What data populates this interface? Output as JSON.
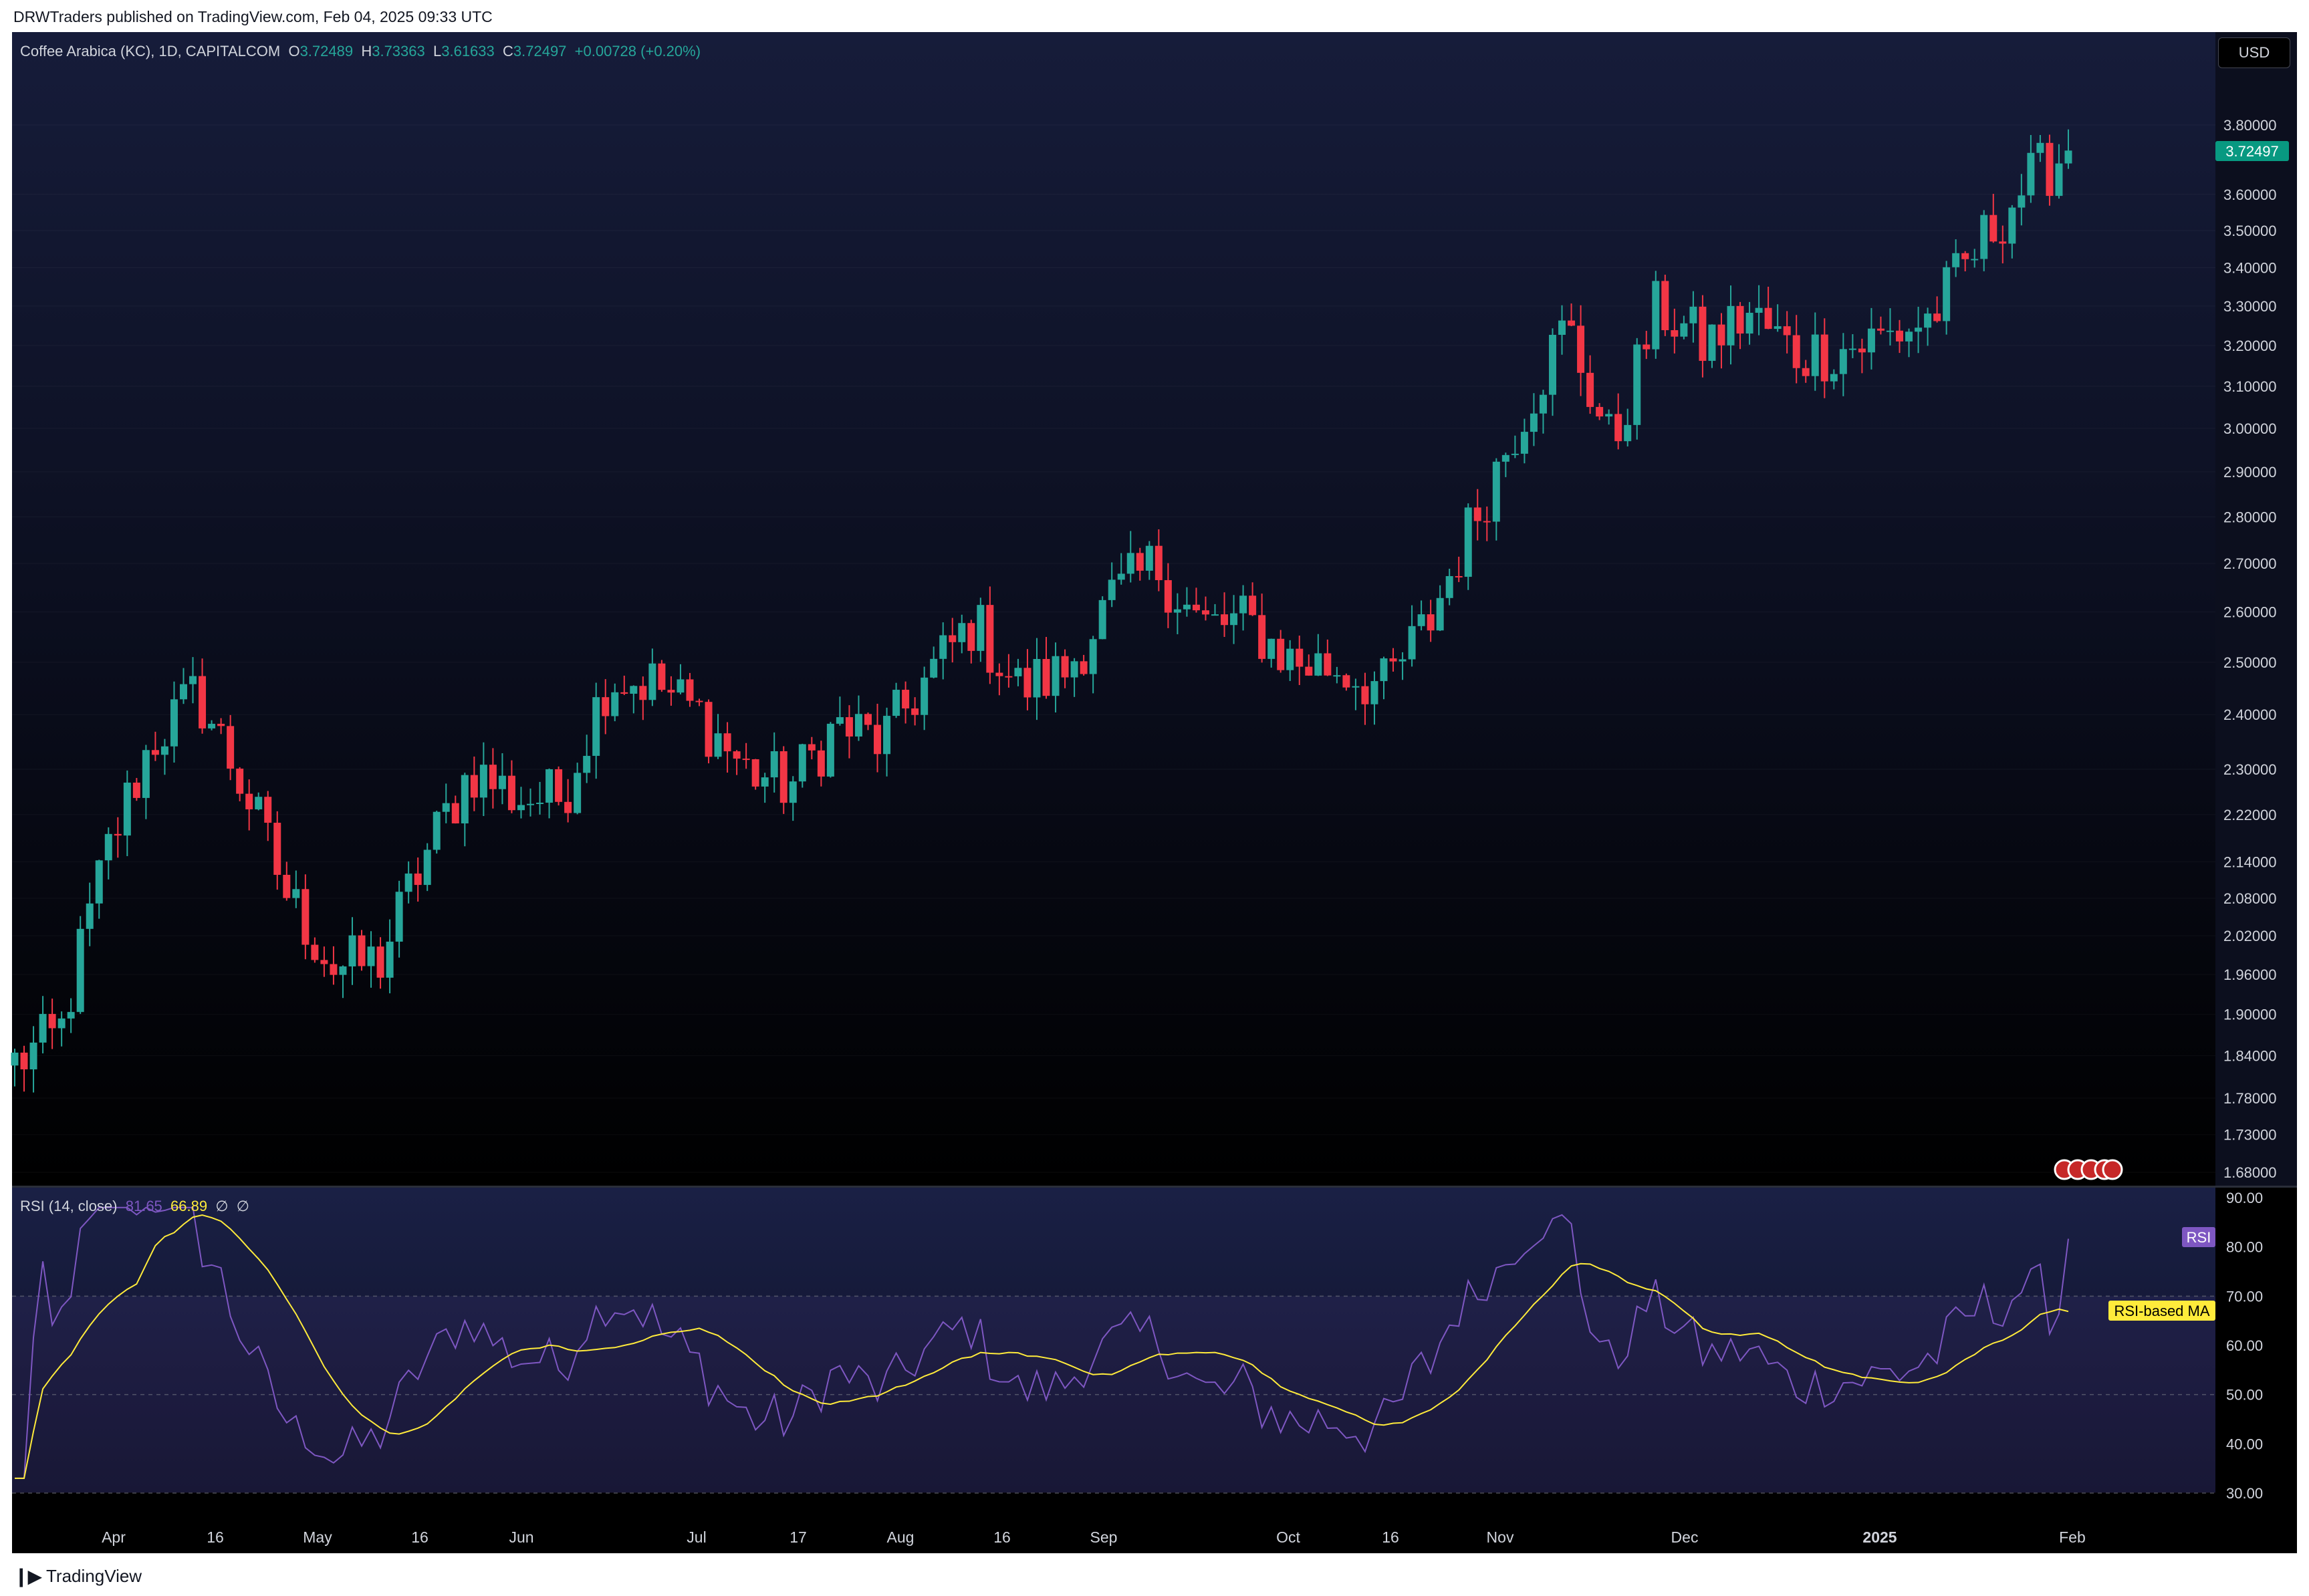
{
  "header": {
    "published": "DRWTraders published on TradingView.com, Feb 04, 2025 09:33 UTC"
  },
  "footer": {
    "brand": "TradingView",
    "logo_icon": "tradingview-logo-icon"
  },
  "legend": {
    "symbol": "Coffee Arabica (KC), 1D, CAPITALCOM",
    "o_label": "O",
    "o_value": "3.72489",
    "h_label": "H",
    "h_value": "3.73363",
    "l_label": "L",
    "l_value": "3.61633",
    "c_label": "C",
    "c_value": "3.72497",
    "change": "+0.00728 (+0.20%)"
  },
  "rsi_legend": {
    "label": "RSI (14, close)",
    "rsi_value": "81.65",
    "ma_value": "66.89",
    "icon1": "∅",
    "icon2": "∅"
  },
  "currency_button": "USD",
  "price_tag": "3.72497",
  "rsi_tag": "RSI",
  "rsi_ma_tag": "RSI-based MA",
  "colors": {
    "up": "#26a69a",
    "down": "#f23645",
    "rsi": "#7e57c2",
    "rsi_ma": "#ffeb3b",
    "background": "#000000"
  },
  "chart_data": [
    {
      "type": "candlestick",
      "title": "Coffee Arabica (KC), 1D, CAPITALCOM",
      "scale": "log",
      "y_ticks": [
        "3.80000",
        "3.60000",
        "3.50000",
        "3.40000",
        "3.30000",
        "3.20000",
        "3.10000",
        "3.00000",
        "2.90000",
        "2.80000",
        "2.70000",
        "2.60000",
        "2.50000",
        "2.40000",
        "2.30000",
        "2.22000",
        "2.14000",
        "2.08000",
        "2.02000",
        "1.96000",
        "1.90000",
        "1.84000",
        "1.78000",
        "1.73000",
        "1.68000"
      ],
      "x_ticks": [
        "Apr",
        "16",
        "May",
        "16",
        "Jun",
        "Jul",
        "17",
        "Aug",
        "16",
        "Sep",
        "Oct",
        "16",
        "Nov",
        "Dec",
        "2025",
        "Feb"
      ],
      "ohlc_approx": [
        {
          "date": "Mar 21",
          "close": 1.83
        },
        {
          "date": "Apr 01",
          "close": 1.87
        },
        {
          "date": "Apr 11",
          "close": 2.15
        },
        {
          "date": "Apr 16",
          "close": 2.35
        },
        {
          "date": "Apr 17",
          "close": 2.44
        },
        {
          "date": "Apr 24",
          "close": 2.27
        },
        {
          "date": "May 01",
          "close": 2.08
        },
        {
          "date": "May 06",
          "close": 1.97
        },
        {
          "date": "May 16",
          "close": 1.98
        },
        {
          "date": "May 27",
          "close": 2.15
        },
        {
          "date": "Jun 04",
          "close": 2.3
        },
        {
          "date": "Jun 14",
          "close": 2.25
        },
        {
          "date": "Jun 26",
          "close": 2.25
        },
        {
          "date": "Jul 03",
          "close": 2.47
        },
        {
          "date": "Jul 10",
          "close": 2.46
        },
        {
          "date": "Jul 17",
          "close": 2.4
        },
        {
          "date": "Jul 24",
          "close": 2.3
        },
        {
          "date": "Aug 02",
          "close": 2.27
        },
        {
          "date": "Aug 09",
          "close": 2.38
        },
        {
          "date": "Aug 16",
          "close": 2.35
        },
        {
          "date": "Aug 23",
          "close": 2.47
        },
        {
          "date": "Aug 30",
          "close": 2.58
        },
        {
          "date": "Sep 06",
          "close": 2.45
        },
        {
          "date": "Sep 13",
          "close": 2.48
        },
        {
          "date": "Sep 20",
          "close": 2.62
        },
        {
          "date": "Sep 27",
          "close": 2.7
        },
        {
          "date": "Oct 04",
          "close": 2.57
        },
        {
          "date": "Oct 11",
          "close": 2.58
        },
        {
          "date": "Oct 18",
          "close": 2.5
        },
        {
          "date": "Oct 25",
          "close": 2.49
        },
        {
          "date": "Nov 01",
          "close": 2.45
        },
        {
          "date": "Nov 08",
          "close": 2.58
        },
        {
          "date": "Nov 15",
          "close": 2.8
        },
        {
          "date": "Nov 22",
          "close": 3.03
        },
        {
          "date": "Nov 29",
          "close": 3.25
        },
        {
          "date": "Dec 03",
          "close": 2.95
        },
        {
          "date": "Dec 10",
          "close": 3.3
        },
        {
          "date": "Dec 17",
          "close": 3.2
        },
        {
          "date": "Dec 24",
          "close": 3.28
        },
        {
          "date": "Dec 31",
          "close": 3.18
        },
        {
          "date": "Jan 08",
          "close": 3.19
        },
        {
          "date": "Jan 15",
          "close": 3.22
        },
        {
          "date": "Jan 22",
          "close": 3.27
        },
        {
          "date": "Jan 27",
          "close": 3.45
        },
        {
          "date": "Jan 30",
          "close": 3.62
        },
        {
          "date": "Jan 31",
          "close": 3.72497
        }
      ]
    },
    {
      "type": "line",
      "title": "RSI (14, close)",
      "y_ticks": [
        "90.00",
        "80.00",
        "70.00",
        "60.00",
        "50.00",
        "40.00",
        "30.00"
      ],
      "ylim": [
        30,
        90
      ],
      "bands": [
        70,
        50,
        30
      ],
      "series": [
        {
          "name": "RSI (14, close)",
          "last": 81.65
        },
        {
          "name": "RSI-based MA",
          "last": 66.89
        }
      ]
    }
  ]
}
